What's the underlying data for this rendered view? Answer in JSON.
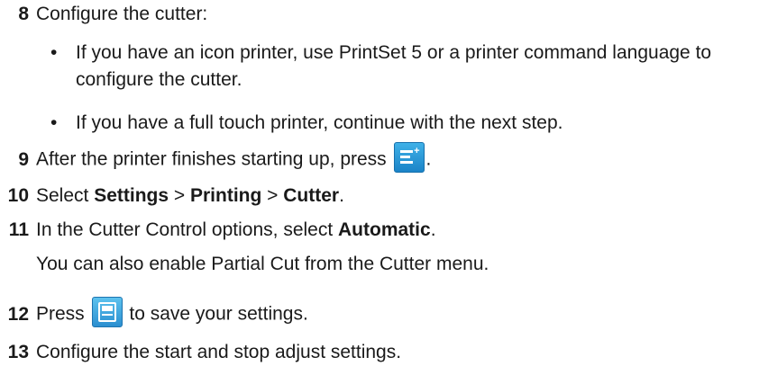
{
  "steps": [
    {
      "num": "8",
      "text": "Configure the cutter:"
    },
    {
      "num": "9",
      "before": "After the printer finishes starting up, press",
      "after": ".",
      "icon": "menu-icon"
    },
    {
      "num": "10",
      "before": "Select ",
      "b1": "Settings",
      "sep1": " > ",
      "b2": "Printing",
      "sep2": " > ",
      "b3": "Cutter",
      "after": "."
    },
    {
      "num": "11",
      "before": "In the Cutter Control options, select ",
      "bold": "Automatic",
      "after": "."
    },
    {
      "num": "12",
      "before": "Press",
      "after": "to save your settings.",
      "icon": "save-icon"
    },
    {
      "num": "13",
      "text": "Configure the start and stop adjust settings."
    }
  ],
  "bullets": [
    "If you have an icon printer, use PrintSet 5 or a printer command language to configure the cutter.",
    "If you have a full touch printer, continue with the next step."
  ],
  "bullet_glyph": "•",
  "note": "You can also enable Partial Cut from the Cutter menu.",
  "icon_colors": {
    "accent": "#2b8fd0",
    "accent_light": "#5dc2ee"
  }
}
